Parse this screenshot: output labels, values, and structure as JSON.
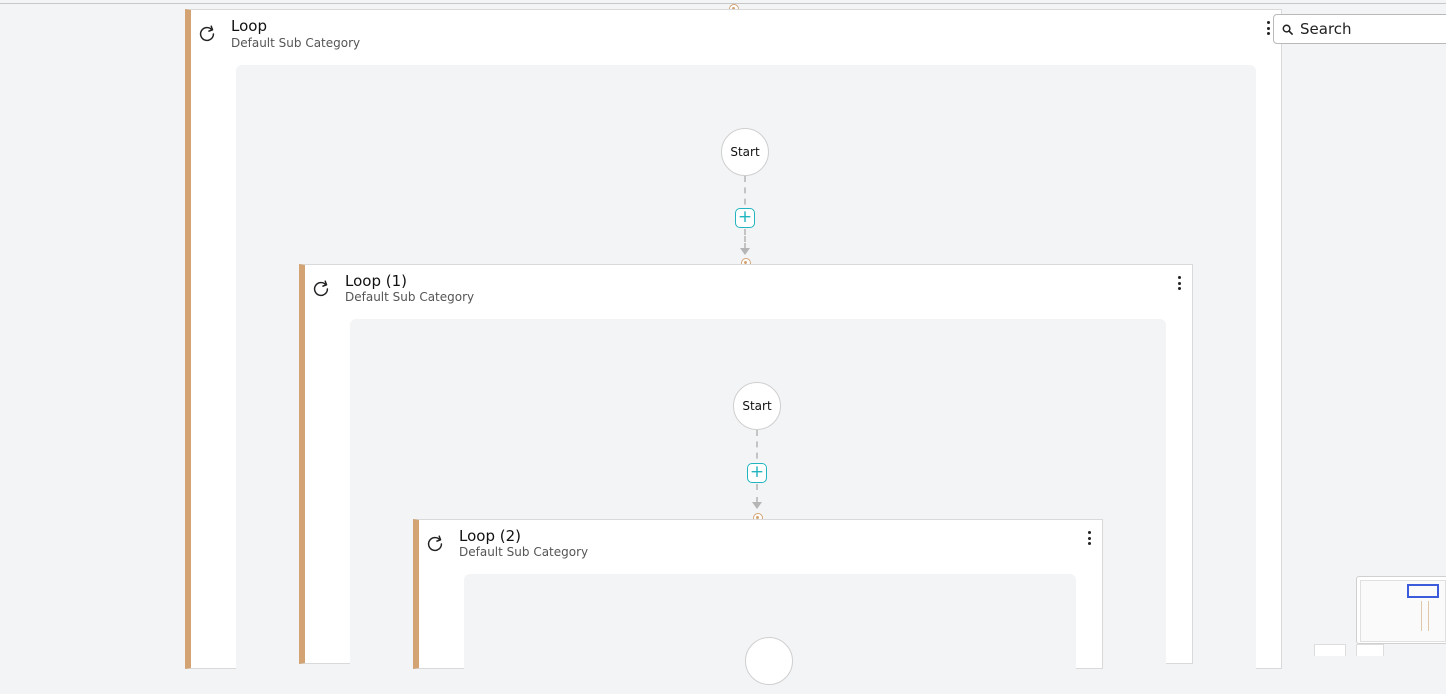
{
  "search": {
    "placeholder": "Search"
  },
  "loops": [
    {
      "title": "Loop",
      "subtitle": "Default Sub Category"
    },
    {
      "title": "Loop (1)",
      "subtitle": "Default Sub Category"
    },
    {
      "title": "Loop (2)",
      "subtitle": "Default Sub Category"
    }
  ],
  "start_label": "Start",
  "plus_label": "+",
  "colors": {
    "accent_loop": "#d4a373",
    "plus": "#22b5c0",
    "minimap_viewport": "#3b5bdb"
  },
  "icons": {
    "loop": "refresh-icon",
    "menu": "kebab-menu-icon",
    "search": "search-icon",
    "add": "plus-icon"
  }
}
